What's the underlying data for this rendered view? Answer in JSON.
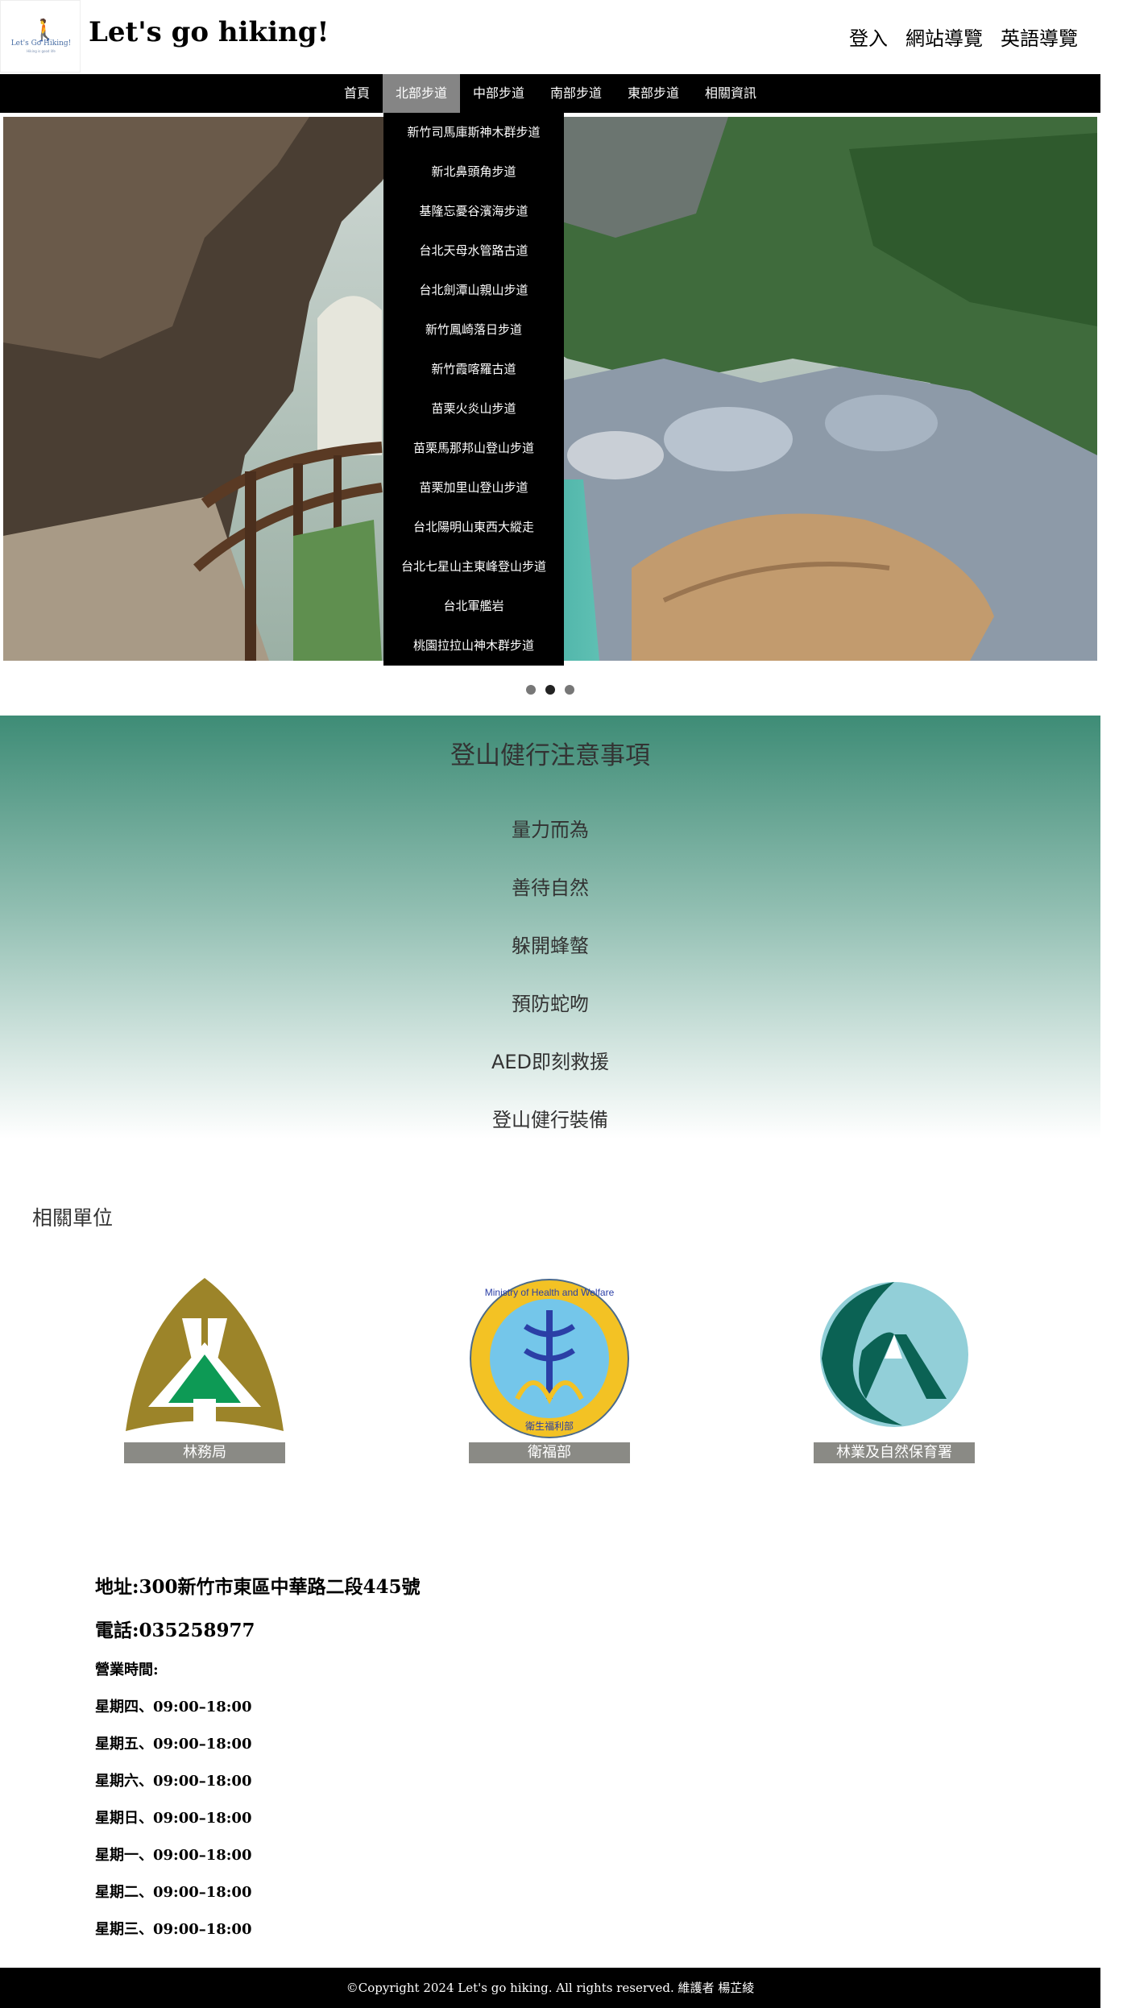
{
  "header": {
    "site_title": "Let's go hiking!",
    "logo_text": "Let's Go Hiking!",
    "logo_subtext": "Hiking is good life",
    "links": [
      "登入",
      "網站導覽",
      "英語導覽"
    ]
  },
  "nav": {
    "items": [
      "首頁",
      "北部步道",
      "中部步道",
      "南部步道",
      "東部步道",
      "相關資訊"
    ],
    "active": "北部步道"
  },
  "dropdown": {
    "items": [
      "新竹司馬庫斯神木群步道",
      "新北鼻頭角步道",
      "基隆忘憂谷濱海步道",
      "台北天母水管路古道",
      "台北劍潭山親山步道",
      "新竹鳳崎落日步道",
      "新竹霞喀羅古道",
      "苗栗火炎山步道",
      "苗栗馬那邦山登山步道",
      "苗栗加里山登山步道",
      "台北陽明山東西大縱走",
      "台北七星山主東峰登山步道",
      "台北軍艦岩",
      "桃園拉拉山神木群步道"
    ]
  },
  "carousel": {
    "slides": 3,
    "active_index": 1
  },
  "tips": {
    "title": "登山健行注意事項",
    "items": [
      "量力而為",
      "善待自然",
      "躲開蜂螫",
      "預防蛇吻",
      "AED即刻救援",
      "登山健行裝備"
    ]
  },
  "related": {
    "title": "相關單位",
    "orgs": [
      {
        "label": "林務局",
        "icon": "forestry-bureau-logo"
      },
      {
        "label": "衛福部",
        "icon": "ministry-health-welfare-logo",
        "logo_text": "Ministry of Health and Welfare",
        "logo_text_cn": "衛生福利部"
      },
      {
        "label": "林業及自然保育署",
        "icon": "forestry-conservation-agency-logo"
      }
    ]
  },
  "contact": {
    "address": "地址:300新竹市東區中華路二段445號",
    "phone": "電話:035258977",
    "hours_title": "營業時間:",
    "hours": [
      "星期四、09:00–18:00",
      "星期五、09:00–18:00",
      "星期六、09:00–18:00",
      "星期日、09:00–18:00",
      "星期一、09:00–18:00",
      "星期二、09:00–18:00",
      "星期三、09:00–18:00"
    ]
  },
  "footer": {
    "text": "©Copyright 2024 Let's go hiking. All rights reserved. 維護者 楊芷綾"
  },
  "colors": {
    "nav_bg": "#000000",
    "nav_active": "#858585",
    "tips_gradient_top": "#3e8c76",
    "org_label_bg": "#8a8a85"
  }
}
